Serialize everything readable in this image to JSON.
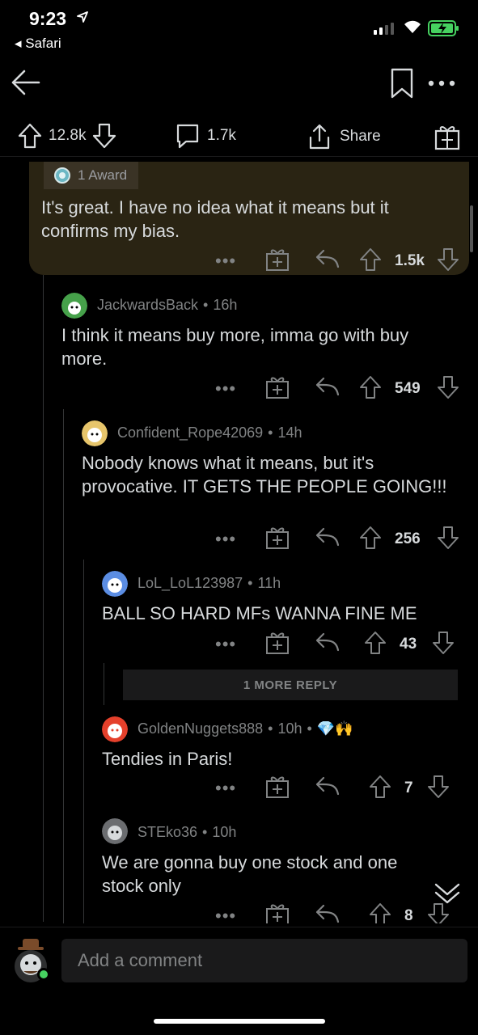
{
  "status_bar": {
    "time": "9:23",
    "back_app": "◂ Safari"
  },
  "action_bar": {
    "upvotes": "12.8k",
    "comments": "1.7k",
    "share_label": "Share"
  },
  "top_comment": {
    "award_label": "1 Award",
    "body": "It's great. I have no idea what it means but it confirms my bias.",
    "score": "1.5k"
  },
  "comments": [
    {
      "author": "JackwardsBack",
      "age": "16h",
      "body": "I think it means buy more, imma go with buy more.",
      "score": "549"
    },
    {
      "author": "Confident_Rope42069",
      "age": "14h",
      "body": "Nobody knows what it means, but it's provocative. IT GETS THE PEOPLE GOING!!!",
      "score": "256"
    },
    {
      "author": "LoL_LoL123987",
      "age": "11h",
      "body": "BALL SO HARD MFs WANNA FINE ME",
      "score": "43"
    },
    {
      "author": "GoldenNuggets888",
      "age": "10h",
      "body": "Tendies in Paris!",
      "score": "7",
      "flair": "💎🙌"
    },
    {
      "author": "STEko36",
      "age": "10h",
      "body": "We are gonna buy one stock and one stock only",
      "score": "8"
    }
  ],
  "more_replies_label": "1 MORE REPLY",
  "composer": {
    "placeholder": "Add a comment"
  },
  "colors": {
    "background": "#000000",
    "text": "#d7dadc",
    "muted": "#818384",
    "online": "#46d160",
    "highlight": "#2a2413"
  }
}
